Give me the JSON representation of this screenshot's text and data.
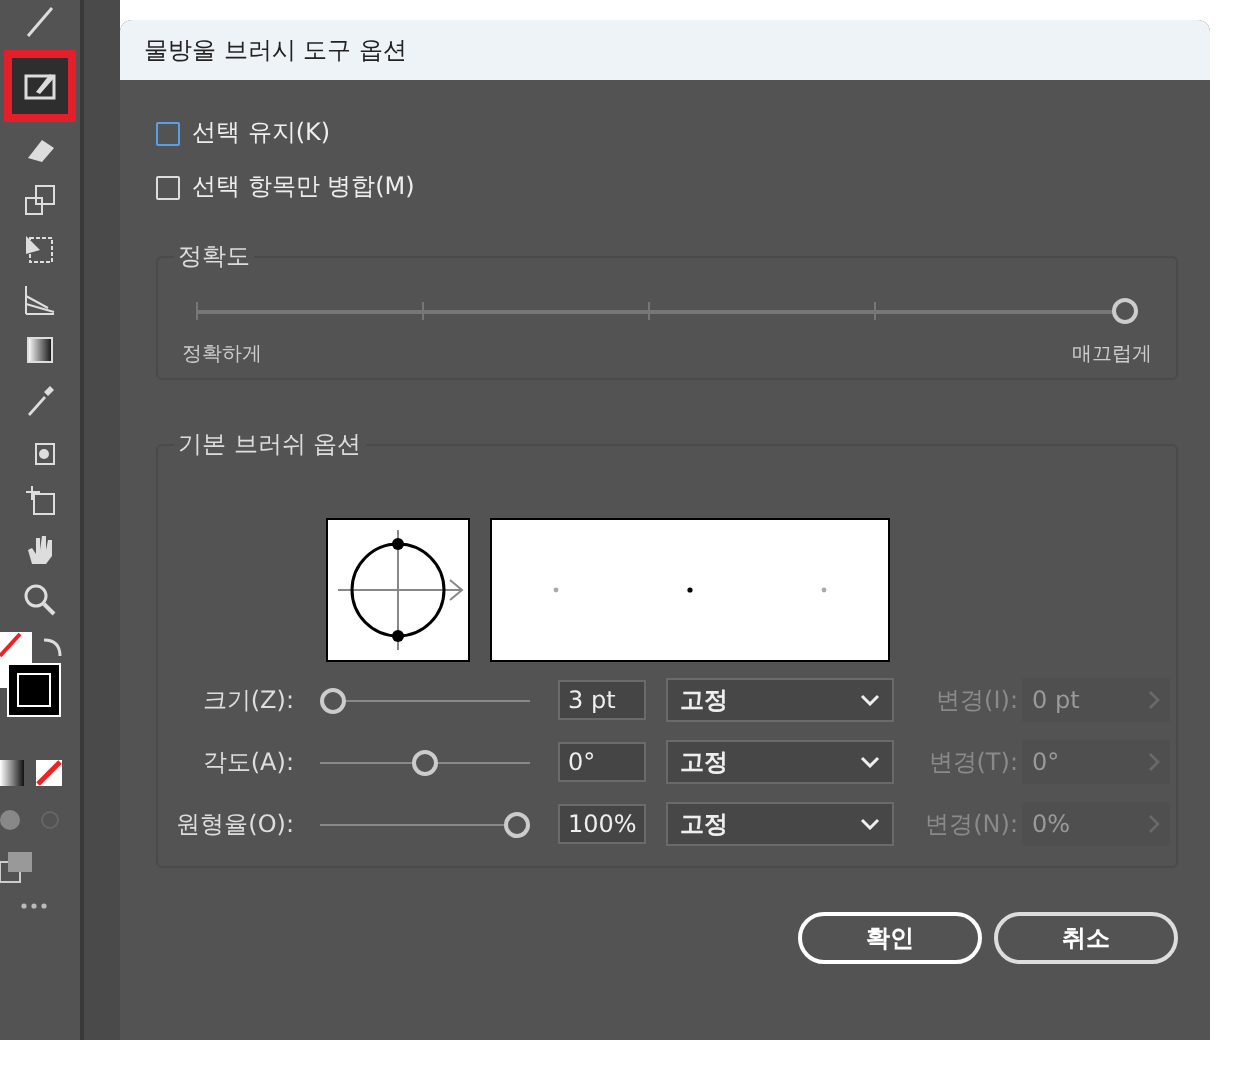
{
  "dialog": {
    "title": "물방울 브러시 도구 옵션",
    "checkboxes": [
      {
        "label": "선택 유지(K)",
        "checked": false,
        "focused": true
      },
      {
        "label": "선택 항목만 병합(M)",
        "checked": false,
        "focused": false
      }
    ],
    "fidelity": {
      "title": "정확도",
      "level": 1,
      "min_label": "정확하게",
      "max_label": "매끄럽게"
    },
    "brush": {
      "title": "기본 브러쉬 옵션",
      "rows": [
        {
          "label": "크기(Z):",
          "level": 0,
          "value": "3 pt",
          "mode": "고정",
          "variation_label": "변경(I):",
          "variation_value": "0 pt",
          "disabled": true
        },
        {
          "label": "각도(A):",
          "level": 0.5,
          "value": "0°",
          "mode": "고정",
          "variation_label": "변경(T):",
          "variation_value": "0°",
          "disabled": true
        },
        {
          "label": "원형율(O):",
          "level": 1,
          "value": "100%",
          "mode": "고정",
          "variation_label": "변경(N):",
          "variation_value": "0%",
          "disabled": true
        }
      ]
    },
    "buttons": [
      {
        "label": "확인",
        "primary": true
      },
      {
        "label": "취소",
        "primary": false
      }
    ]
  }
}
